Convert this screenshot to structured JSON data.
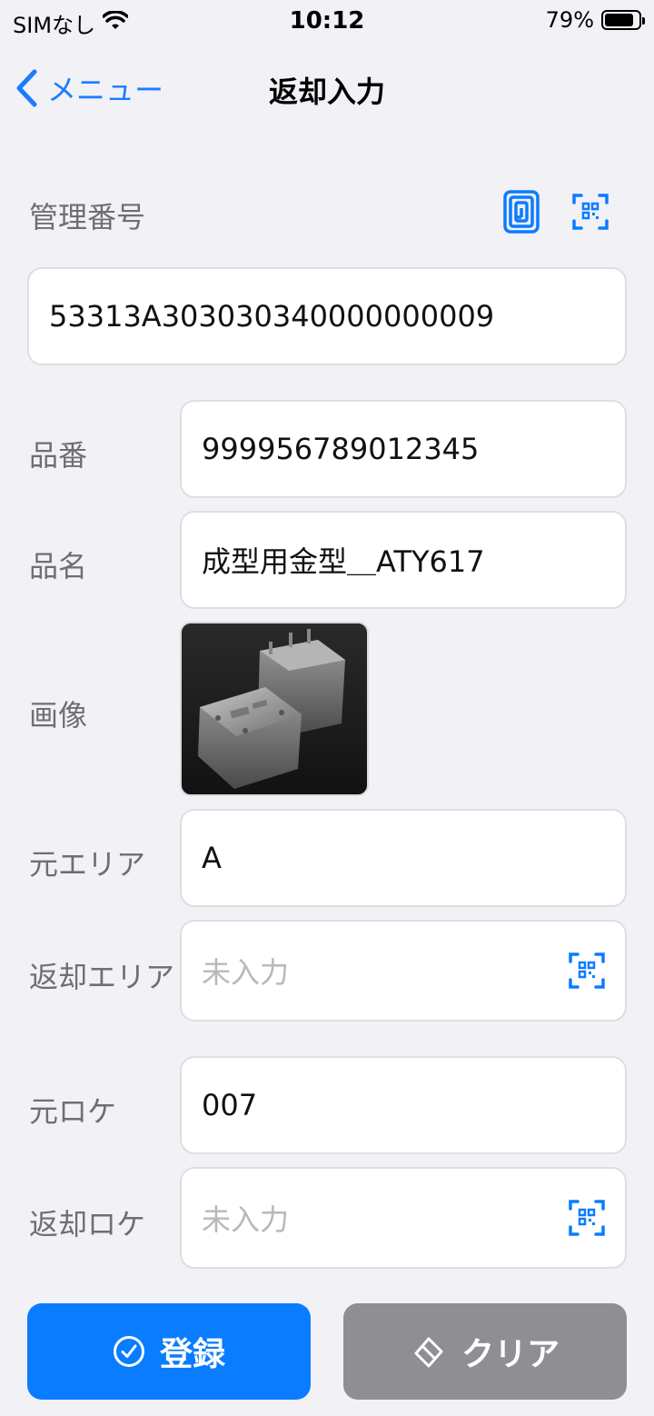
{
  "status_bar": {
    "carrier": "SIMなし",
    "time": "10:12",
    "battery": "79%"
  },
  "nav": {
    "back_label": "メニュー",
    "title": "返却入力"
  },
  "form": {
    "management_number": {
      "label": "管理番号",
      "value": "53313A303030340000000009"
    },
    "product_number": {
      "label": "品番",
      "value": "999956789012345"
    },
    "product_name": {
      "label": "品名",
      "value": "成型用金型＿ATY617"
    },
    "image": {
      "label": "画像"
    },
    "source_area": {
      "label": "元エリア",
      "value": "A"
    },
    "return_area": {
      "label": "返却エリア",
      "placeholder": "未入力"
    },
    "source_location": {
      "label": "元ロケ",
      "value": "007"
    },
    "return_location": {
      "label": "返却ロケ",
      "placeholder": "未入力"
    }
  },
  "buttons": {
    "register": "登録",
    "clear": "クリア"
  },
  "icons": {
    "accent": "#0a7cff",
    "nfc": "nfc-icon",
    "qr": "qr-scan-icon"
  }
}
